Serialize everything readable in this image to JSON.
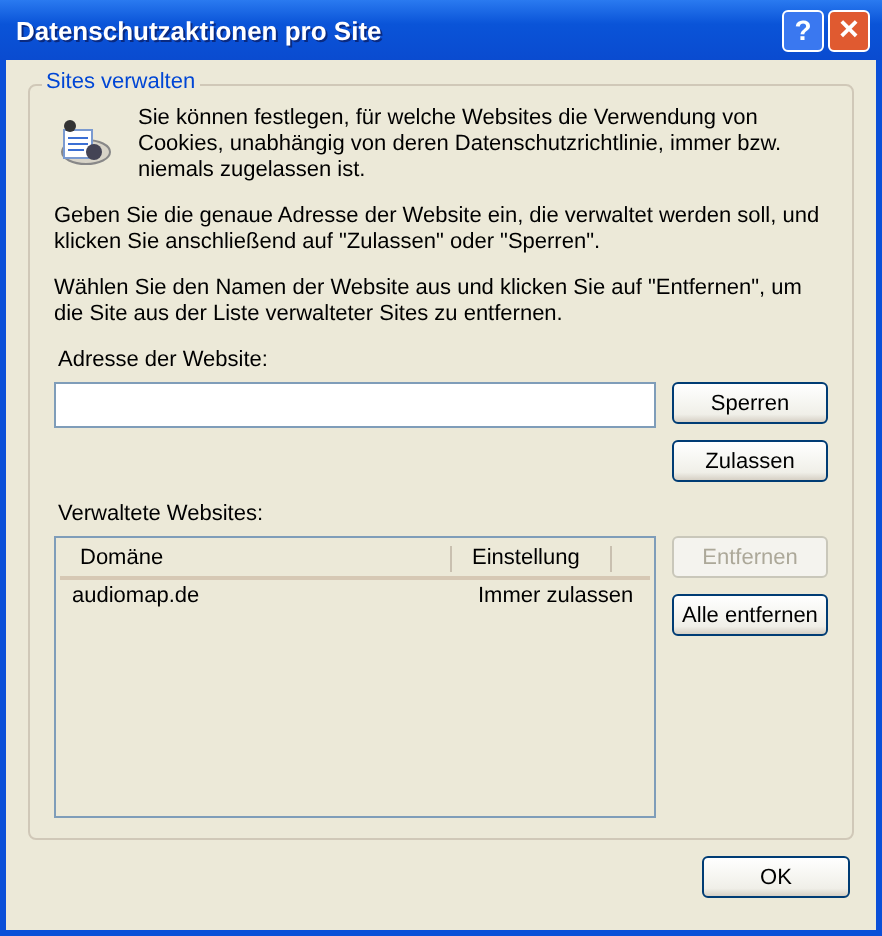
{
  "window": {
    "title": "Datenschutzaktionen pro Site",
    "help_button": "?",
    "close_button": "×"
  },
  "group": {
    "title": "Sites verwalten",
    "intro": "Sie können festlegen, für welche Websites die Verwendung von Cookies, unabhängig von deren Datenschutzrichtlinie, immer bzw. niemals zugelassen ist.",
    "paragraphs": [
      "Geben Sie die genaue Adresse der Website ein, die verwaltet werden soll, und klicken Sie anschließend auf \"Zulassen\" oder \"Sperren\".",
      "Wählen Sie den Namen der Website aus und klicken Sie auf \"Entfernen\", um die Site aus der Liste verwalteter Sites zu entfernen."
    ],
    "address_label": "Adresse der Website:",
    "address_buttons": [
      {
        "label": "Sperren",
        "disabled": false
      },
      {
        "label": "Zulassen",
        "disabled": false
      }
    ],
    "list_label": "Verwaltete Websites:",
    "columns": [
      "Domäne",
      "Einstellung"
    ],
    "rows": [
      {
        "domain": "audiomap.de",
        "setting": "Immer zulassen"
      }
    ],
    "list_buttons": [
      {
        "label": "Entfernen",
        "disabled": true
      },
      {
        "label": "Alle entfernen",
        "disabled": false
      }
    ]
  },
  "buttons": [
    "OK"
  ]
}
